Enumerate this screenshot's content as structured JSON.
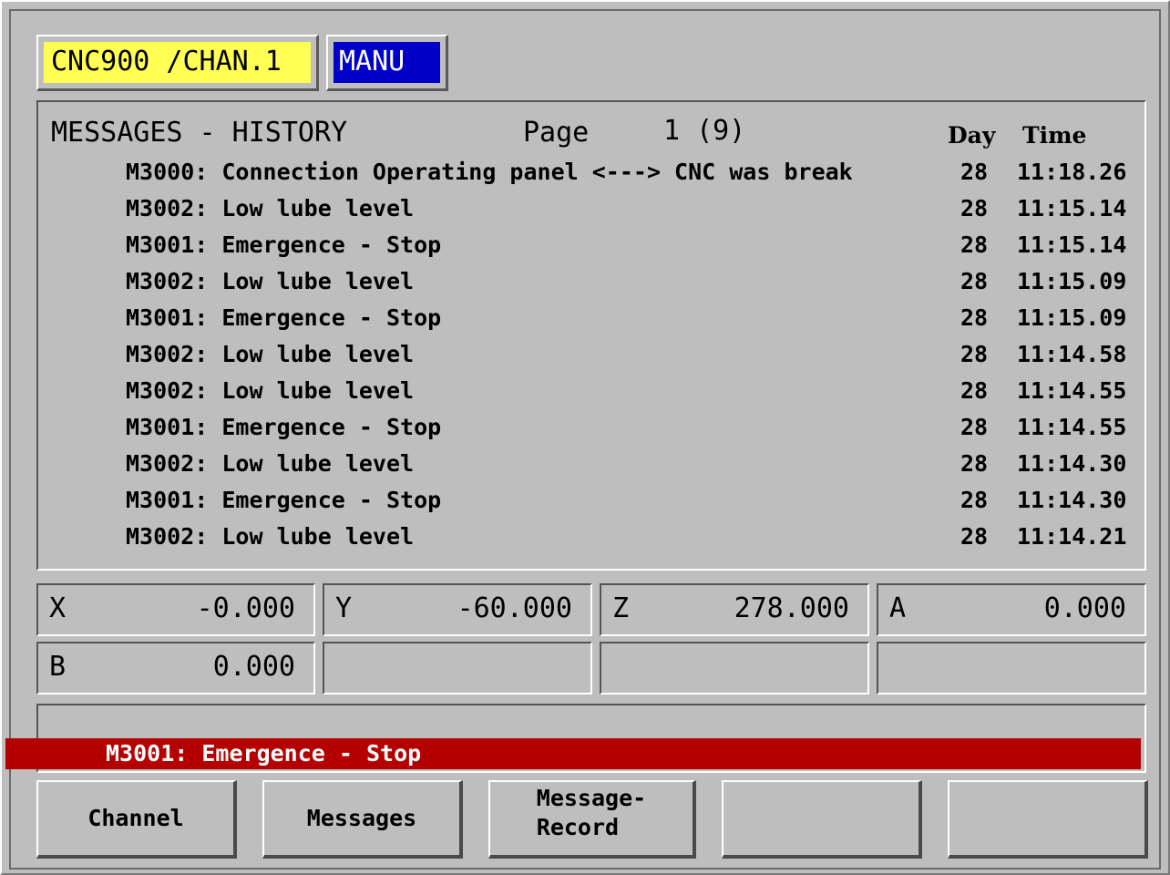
{
  "header": {
    "channel_label": "CNC900 /CHAN.1",
    "mode_label": "MANU",
    "colors": {
      "channel_bg": "#ffff55",
      "mode_bg": "#0000c8",
      "alarm_bg": "#b40000"
    }
  },
  "messages": {
    "title": "MESSAGES - HISTORY",
    "page_label": "Page",
    "page_number": "1 (9)",
    "col_day": "Day",
    "col_time": "Time",
    "rows": [
      {
        "text": "M3000: Connection Operating panel <---> CNC was break",
        "day": "28",
        "time": "11:18.26"
      },
      {
        "text": "M3002: Low lube level",
        "day": "28",
        "time": "11:15.14"
      },
      {
        "text": "M3001: Emergence - Stop",
        "day": "28",
        "time": "11:15.14"
      },
      {
        "text": "M3002: Low lube level",
        "day": "28",
        "time": "11:15.09"
      },
      {
        "text": "M3001: Emergence - Stop",
        "day": "28",
        "time": "11:15.09"
      },
      {
        "text": "M3002: Low lube level",
        "day": "28",
        "time": "11:14.58"
      },
      {
        "text": "M3002: Low lube level",
        "day": "28",
        "time": "11:14.55"
      },
      {
        "text": "M3001: Emergence - Stop",
        "day": "28",
        "time": "11:14.55"
      },
      {
        "text": "M3002: Low lube level",
        "day": "28",
        "time": "11:14.30"
      },
      {
        "text": "M3001: Emergence - Stop",
        "day": "28",
        "time": "11:14.30"
      },
      {
        "text": "M3002: Low lube level",
        "day": "28",
        "time": "11:14.21"
      }
    ]
  },
  "axes": [
    {
      "label": "X",
      "value": "-0.000"
    },
    {
      "label": "Y",
      "value": "-60.000"
    },
    {
      "label": "Z",
      "value": "278.000"
    },
    {
      "label": "A",
      "value": "0.000"
    },
    {
      "label": "B",
      "value": "0.000"
    },
    {
      "label": "",
      "value": ""
    },
    {
      "label": "",
      "value": ""
    },
    {
      "label": "",
      "value": ""
    }
  ],
  "status": {
    "alarm_text": "M3001: Emergence - Stop"
  },
  "softkeys": [
    {
      "label": "Channel"
    },
    {
      "label": "Messages"
    },
    {
      "label": "Message-\nRecord"
    },
    {
      "label": ""
    },
    {
      "label": ""
    }
  ]
}
